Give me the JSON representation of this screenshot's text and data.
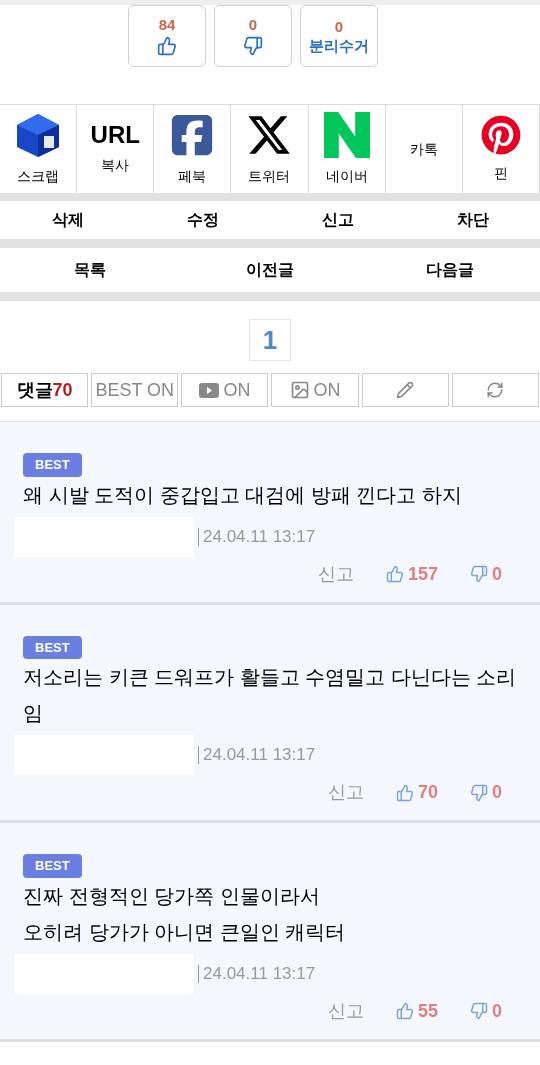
{
  "votes": [
    {
      "kind": "up",
      "count": "84"
    },
    {
      "kind": "down",
      "count": "0"
    },
    {
      "kind": "recycle",
      "count": "0",
      "label": "분리수거"
    }
  ],
  "share": [
    {
      "kind": "scrap",
      "label": "스크랩"
    },
    {
      "kind": "url",
      "text": "URL",
      "label": "복사"
    },
    {
      "kind": "facebook",
      "label": "페북"
    },
    {
      "kind": "x",
      "label": "트위터"
    },
    {
      "kind": "naver",
      "label": "네이버"
    },
    {
      "kind": "kakao",
      "label": "카톡"
    },
    {
      "kind": "pinterest",
      "label": "핀"
    }
  ],
  "actions": [
    "삭제",
    "수정",
    "신고",
    "차단"
  ],
  "nav": [
    "목록",
    "이전글",
    "다음글"
  ],
  "pagination": [
    {
      "label": "1",
      "selected": true
    }
  ],
  "comment_toolbar": {
    "label": "댓글",
    "count": "70",
    "filters": [
      {
        "kind": "best",
        "label": "BEST ON"
      },
      {
        "kind": "video",
        "label": "ON"
      },
      {
        "kind": "image",
        "label": "ON"
      }
    ],
    "tools": [
      {
        "kind": "write"
      },
      {
        "kind": "refresh"
      }
    ]
  },
  "comments": [
    {
      "badge": "BEST",
      "text": "왜 시발 도적이 중갑입고 대검에 방패 낀다고 하지",
      "date": "24.04.11 13:17",
      "report": "신고",
      "likes": "157",
      "dislikes": "0"
    },
    {
      "badge": "BEST",
      "text": "저소리는 키큰 드워프가 활들고 수염밀고 다닌다는 소리임",
      "date": "24.04.11 13:17",
      "report": "신고",
      "likes": "70",
      "dislikes": "0"
    },
    {
      "badge": "BEST",
      "text": "진짜 전형적인 당가쪽 인물이라서\n오히려 당가가 아니면 큰일인 캐릭터",
      "date": "24.04.11 13:17",
      "report": "신고",
      "likes": "55",
      "dislikes": "0"
    }
  ]
}
